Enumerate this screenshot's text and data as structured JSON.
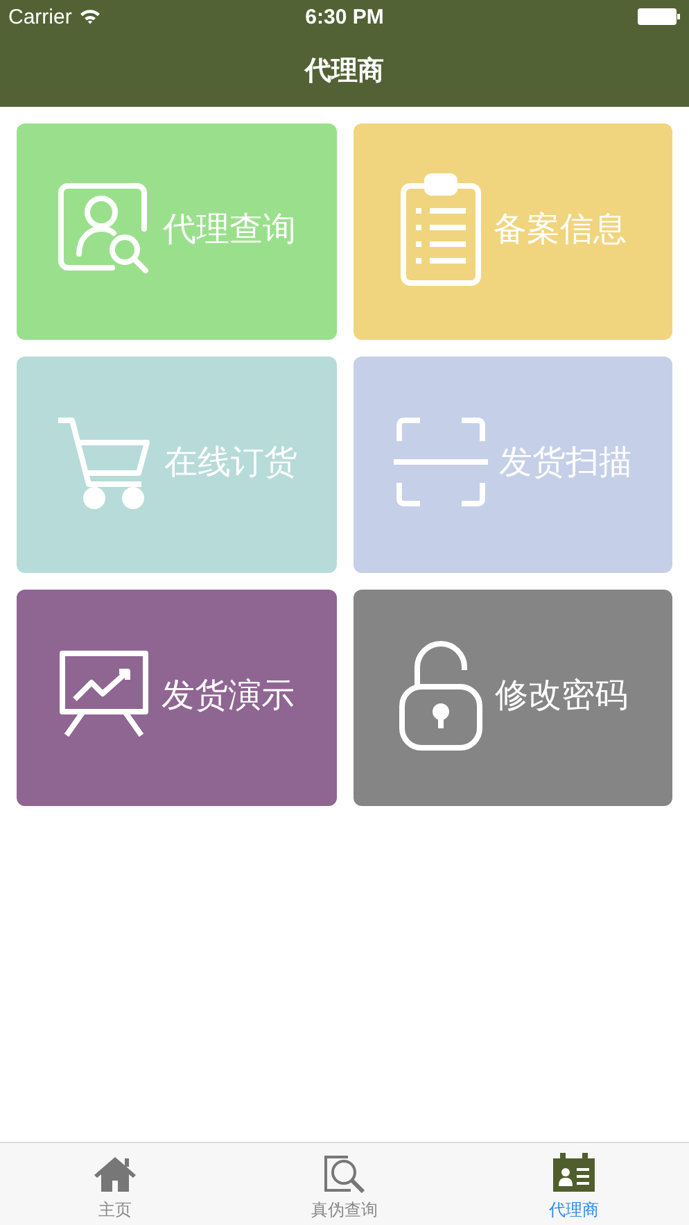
{
  "status_bar": {
    "carrier": "Carrier",
    "time": "6:30 PM"
  },
  "nav_bar": {
    "title": "代理商"
  },
  "tiles": [
    {
      "kind": "agent-search",
      "label": "代理查询",
      "color": "#9ae08c"
    },
    {
      "kind": "clipboard",
      "label": "备案信息",
      "color": "#f0d57e"
    },
    {
      "kind": "cart",
      "label": "在线订货",
      "color": "#b7dbd9"
    },
    {
      "kind": "scan",
      "label": "发货扫描",
      "color": "#c5cfe8"
    },
    {
      "kind": "chart",
      "label": "发货演示",
      "color": "#8f6592"
    },
    {
      "kind": "lock",
      "label": "修改密码",
      "color": "#858585"
    }
  ],
  "tab_bar": [
    {
      "kind": "home",
      "label": "主页",
      "selected": false
    },
    {
      "kind": "search",
      "label": "真伪查询",
      "selected": false
    },
    {
      "kind": "agent",
      "label": "代理商",
      "selected": true
    }
  ]
}
